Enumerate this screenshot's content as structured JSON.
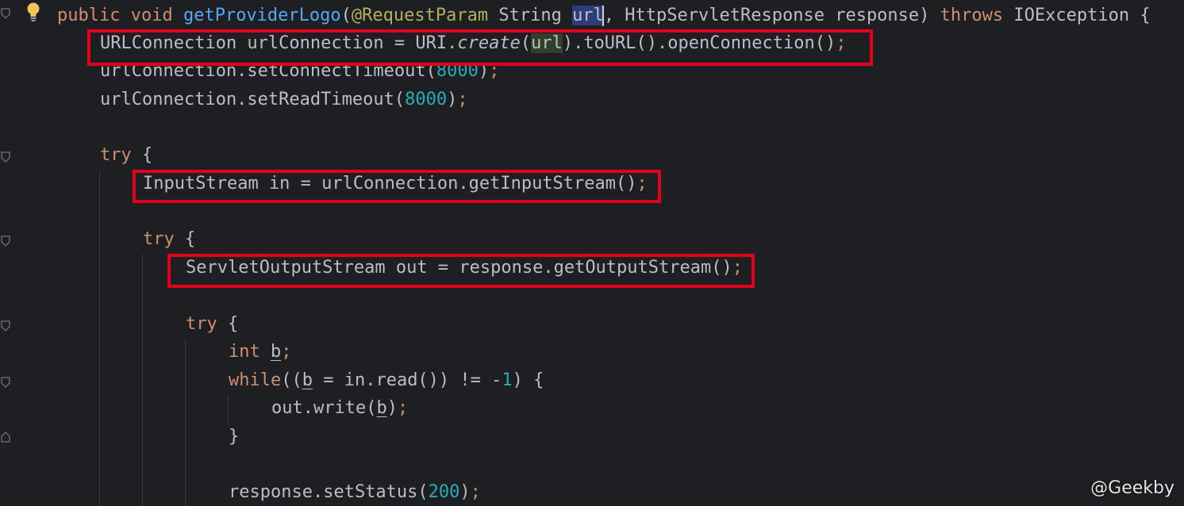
{
  "code": {
    "line1": {
      "kw_public": "public",
      "kw_void": "void",
      "method": "getProviderLogo",
      "paren_open": "(",
      "annotation": "@RequestParam",
      "type_string": " String ",
      "param_url": "url",
      "sep1": ", HttpServletResponse response) ",
      "kw_throws": "throws",
      "tail": " IOException {"
    },
    "line2": {
      "a": "URLConnection urlConnection = URI.",
      "create": "create",
      "b": "(",
      "url": "url",
      "c": ").toURL().openConnection()",
      "semi": ";"
    },
    "line3": {
      "a": "urlConnection.setConnectTimeout(",
      "num": "8000",
      "b": ")",
      "semi": ";"
    },
    "line4": {
      "a": "urlConnection.setReadTimeout(",
      "num": "8000",
      "b": ")",
      "semi": ";"
    },
    "line5": {
      "kw": "try",
      "b": " {"
    },
    "line6": {
      "a": "InputStream in = urlConnection.getInputStream()",
      "semi": ";"
    },
    "line7": {
      "kw": "try",
      "b": " {"
    },
    "line8": {
      "a": "ServletOutputStream out = response.getOutputStream()",
      "semi": ";"
    },
    "line9": {
      "kw": "try",
      "b": " {"
    },
    "line10": {
      "kw": "int",
      "sp": " ",
      "var": "b",
      "semi": ";"
    },
    "line11": {
      "kw": "while",
      "a": "((",
      "var": "b",
      "b": " = in.read()) != -",
      "num": "1",
      "c": ") {"
    },
    "line12": {
      "a": "out.write(",
      "var": "b",
      "b": ")",
      "semi": ";"
    },
    "line13": {
      "a": "}"
    },
    "line14": {
      "a": "response.setStatus(",
      "num": "200",
      "b": ")",
      "semi": ";"
    }
  },
  "watermark": "@Geekby",
  "colors": {
    "background": "#1e1f22",
    "keyword": "#cf8e6d",
    "text": "#bcbec4",
    "number": "#2aacb8",
    "annotation": "#b3ae60",
    "method": "#56a8f5",
    "highlight_box": "#e4001b"
  }
}
